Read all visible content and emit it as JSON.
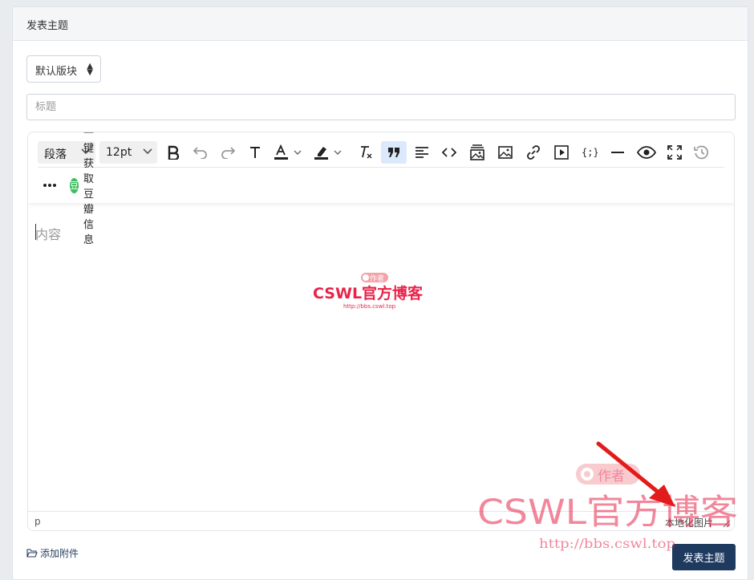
{
  "header": {
    "title": "发表主题"
  },
  "forum_select": {
    "selected": "默认版块"
  },
  "title_input": {
    "placeholder": "标题",
    "value": ""
  },
  "toolbar": {
    "block_format": "段落",
    "font_size": "12pt",
    "douban_label": "一键获取豆瓣信息",
    "douban_badge": "豆"
  },
  "editor": {
    "placeholder": "内容",
    "status_path": "p",
    "localize_images_label": "本地化图片"
  },
  "footer": {
    "attach_label": "添加附件",
    "submit_label": "发表主题"
  },
  "watermark": {
    "brand": "CSWL官方博客",
    "url": "http://bbs.cswl.top",
    "tag": "作者"
  },
  "colors": {
    "submit_bg": "#1f3a5f",
    "active_tool_bg": "#dbe9fb",
    "watermark_red": "#e8244a",
    "arrow_red": "#e21b1b",
    "douban_green": "#3fbf62"
  }
}
